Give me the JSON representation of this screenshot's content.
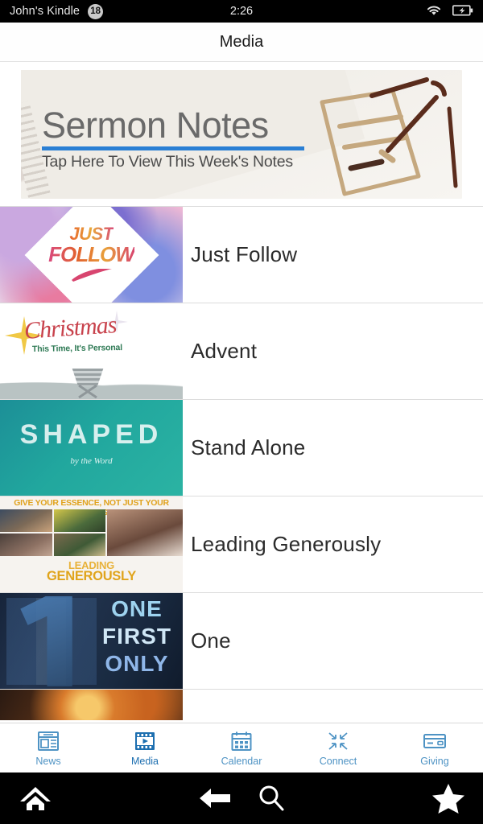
{
  "statusbar": {
    "device_name": "John's Kindle",
    "badge_count": "18",
    "time": "2:26",
    "wifi_icon": "wifi-icon",
    "battery_icon": "battery-charging-icon"
  },
  "header": {
    "title": "Media"
  },
  "banner": {
    "name": "sermon-notes-banner",
    "heading": "Sermon Notes",
    "subheading": "Tap Here To View This Week's Notes",
    "rule_color": "#2a7fd4",
    "heading_color": "#6a6a6a",
    "art_icon": "notepad-pencil-icon"
  },
  "media_list": [
    {
      "title": "Just Follow",
      "thumb_name": "just-follow-thumbnail",
      "thumb_text": {
        "line1": "JUST",
        "line2": "FOLLOW",
        "mark": "swoosh-icon"
      }
    },
    {
      "title": "Advent",
      "thumb_name": "advent-christmas-thumbnail",
      "thumb_text": {
        "line1": "Christmas",
        "line2": "This Time, It's Personal",
        "mark": "star-manger-icon"
      }
    },
    {
      "title": "Stand Alone",
      "thumb_name": "shaped-thumbnail",
      "thumb_text": {
        "line1": "SHAPED",
        "line2": "by the Word"
      }
    },
    {
      "title": "Leading Generously",
      "thumb_name": "leading-generously-thumbnail",
      "thumb_text": {
        "line1": "GIVE YOUR ESSENCE, NOT JUST YOUR EXCESS",
        "line2": "LEADING",
        "line3": "GENEROUSLY"
      }
    },
    {
      "title": "One",
      "thumb_name": "one-first-only-thumbnail",
      "thumb_text": {
        "line1": "ONE",
        "line2": "FIRST",
        "line3": "ONLY"
      }
    },
    {
      "title": "",
      "thumb_name": "next-series-thumbnail-partial",
      "thumb_text": {}
    }
  ],
  "tabbar": {
    "active": "Media",
    "items": [
      {
        "label": "News",
        "icon": "newspaper-icon"
      },
      {
        "label": "Media",
        "icon": "film-play-icon"
      },
      {
        "label": "Calendar",
        "icon": "calendar-icon"
      },
      {
        "label": "Connect",
        "icon": "connect-arrows-icon"
      },
      {
        "label": "Giving",
        "icon": "credit-card-icon"
      }
    ],
    "color": "#4e93c4",
    "active_color": "#1d6fb0"
  },
  "system_nav": {
    "home_icon": "home-icon",
    "back_icon": "back-arrow-icon",
    "search_icon": "search-icon",
    "favorites_icon": "star-icon"
  }
}
